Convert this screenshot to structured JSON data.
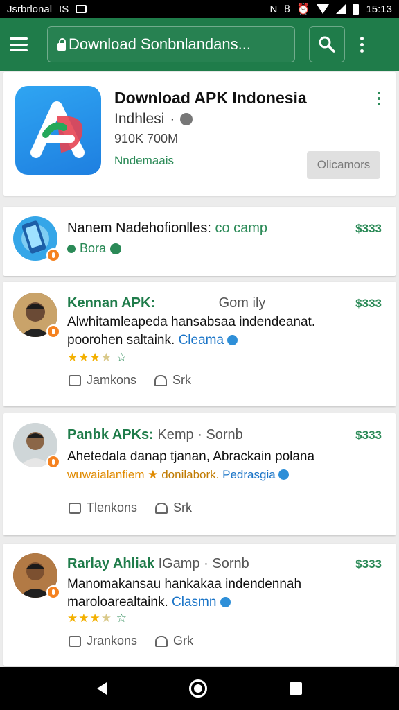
{
  "status_bar": {
    "left_text": "Jsrbrlonal",
    "left_text2": "IS",
    "time": "15:13"
  },
  "app_bar": {
    "search_text": "Download Sonbnlandans..."
  },
  "app": {
    "title": "Download APK Indonesia",
    "developer": "Indhlesi",
    "stats": "910K 700M",
    "category": "Nndemaais",
    "install_label": "Olicamors"
  },
  "items": [
    {
      "name": "Nanem Nadehofionlles:",
      "tag": "co camp",
      "price": "$333",
      "sub": "Bora"
    },
    {
      "name": "Kennan APK:",
      "tag": "Gom ily",
      "price": "$333",
      "text": "Alwhitamleapeda hansabsaa indendeanat.",
      "text2": "poorohen saltaink.",
      "link": "Cleama",
      "like": "Jamkons",
      "share": "Srk"
    },
    {
      "name": "Panbk APKs:",
      "grey": "Kemp",
      "tag": "Sornb",
      "price": "$333",
      "text": "Ahetedala danap tjanan, Abrackain polana",
      "text2": "wuwaialanfiem",
      "text3": "donilabork.",
      "link": "Pedrasgia",
      "like": "Tlenkons",
      "share": "Srk"
    },
    {
      "name": "Rarlay Ahliak",
      "grey": "IGamp",
      "tag": "Sornb",
      "price": "$333",
      "text": "Manomakansau hankakaa indendennah",
      "text2": "maroloarealtaink.",
      "link": "Clasmn",
      "like": "Jrankons",
      "share": "Grk"
    }
  ],
  "colors": {
    "brand": "#1f7c4a",
    "accent": "#2b8a57",
    "link": "#1a74c7"
  }
}
